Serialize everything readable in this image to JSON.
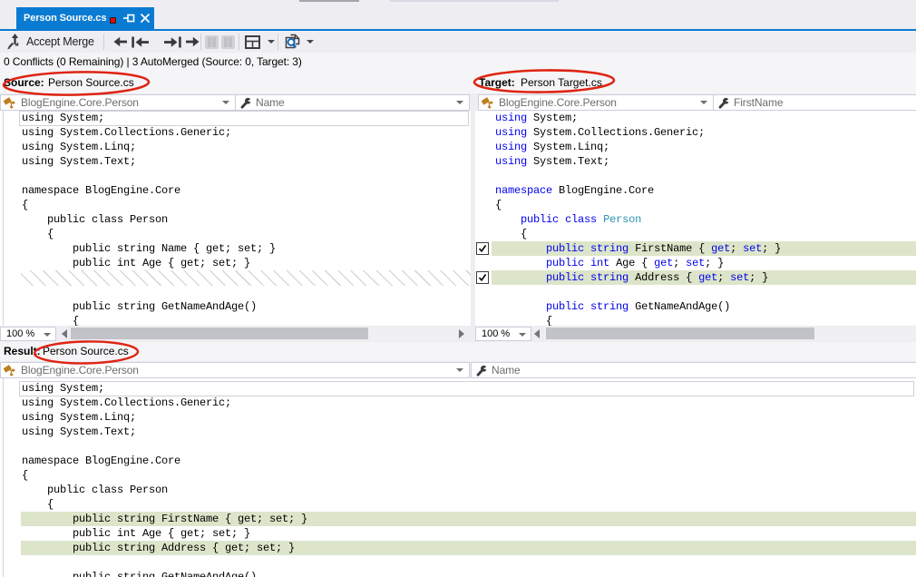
{
  "tab": {
    "title": "Person Source.cs"
  },
  "toolbar": {
    "accept_merge": "Accept Merge",
    "nav_icons": [
      "previous-difference",
      "first-difference",
      "last-difference",
      "next-difference"
    ]
  },
  "status": {
    "text": "0 Conflicts (0 Remaining) | 3 AutoMerged (Source: 0, Target: 3)"
  },
  "panes": {
    "source": {
      "label": "Source:",
      "file": "Person Source.cs",
      "nav_scope": "BlogEngine.Core.Person",
      "nav_member": "Name",
      "zoom": "100 %",
      "lines": [
        {
          "text": "using System;",
          "box": true
        },
        {
          "text": "using System.Collections.Generic;"
        },
        {
          "text": "using System.Linq;"
        },
        {
          "text": "using System.Text;"
        },
        {
          "text": ""
        },
        {
          "text": "namespace BlogEngine.Core"
        },
        {
          "text": "{"
        },
        {
          "text": "    public class Person"
        },
        {
          "text": "    {"
        },
        {
          "text": "        public string Name { get; set; }"
        },
        {
          "text": "        public int Age { get; set; }"
        },
        {
          "hatch": true
        },
        {
          "text": ""
        },
        {
          "text": "        public string GetNameAndAge()"
        },
        {
          "text": "        {"
        }
      ]
    },
    "target": {
      "label": "Target:",
      "file": "Person Target.cs",
      "nav_scope": "BlogEngine.Core.Person",
      "nav_member": "FirstName",
      "zoom": "100 %",
      "lines": [
        {
          "tokens": [
            [
              "k",
              "using"
            ],
            [
              "p",
              " System;"
            ]
          ]
        },
        {
          "tokens": [
            [
              "k",
              "using"
            ],
            [
              "p",
              " System.Collections.Generic;"
            ]
          ]
        },
        {
          "tokens": [
            [
              "k",
              "using"
            ],
            [
              "p",
              " System.Linq;"
            ]
          ]
        },
        {
          "tokens": [
            [
              "k",
              "using"
            ],
            [
              "p",
              " System.Text;"
            ]
          ]
        },
        {
          "tokens": []
        },
        {
          "tokens": [
            [
              "k",
              "namespace"
            ],
            [
              "p",
              " BlogEngine.Core"
            ]
          ]
        },
        {
          "tokens": [
            [
              "p",
              "{"
            ]
          ]
        },
        {
          "tokens": [
            [
              "p",
              "    "
            ],
            [
              "k",
              "public"
            ],
            [
              "p",
              " "
            ],
            [
              "k",
              "class"
            ],
            [
              "p",
              " "
            ],
            [
              "t",
              "Person"
            ]
          ]
        },
        {
          "tokens": [
            [
              "p",
              "    {"
            ]
          ]
        },
        {
          "tokens": [
            [
              "p",
              "        "
            ],
            [
              "k",
              "public"
            ],
            [
              "p",
              " "
            ],
            [
              "k",
              "string"
            ],
            [
              "p",
              " FirstName { "
            ],
            [
              "k",
              "get"
            ],
            [
              "p",
              "; "
            ],
            [
              "k",
              "set"
            ],
            [
              "p",
              "; }"
            ]
          ],
          "hl": true,
          "cb": true
        },
        {
          "tokens": [
            [
              "p",
              "        "
            ],
            [
              "k",
              "public"
            ],
            [
              "p",
              " "
            ],
            [
              "k",
              "int"
            ],
            [
              "p",
              " Age { "
            ],
            [
              "k",
              "get"
            ],
            [
              "p",
              "; "
            ],
            [
              "k",
              "set"
            ],
            [
              "p",
              "; }"
            ]
          ]
        },
        {
          "tokens": [
            [
              "p",
              "        "
            ],
            [
              "k",
              "public"
            ],
            [
              "p",
              " "
            ],
            [
              "k",
              "string"
            ],
            [
              "p",
              " Address { "
            ],
            [
              "k",
              "get"
            ],
            [
              "p",
              "; "
            ],
            [
              "k",
              "set"
            ],
            [
              "p",
              "; }"
            ]
          ],
          "hl": true,
          "cb": true
        },
        {
          "tokens": []
        },
        {
          "tokens": [
            [
              "p",
              "        "
            ],
            [
              "k",
              "public"
            ],
            [
              "p",
              " "
            ],
            [
              "k",
              "string"
            ],
            [
              "p",
              " GetNameAndAge()"
            ]
          ]
        },
        {
          "tokens": [
            [
              "p",
              "        {"
            ]
          ]
        }
      ]
    },
    "result": {
      "label": "Result:",
      "file": "Person Source.cs",
      "nav_scope": "BlogEngine.Core.Person",
      "nav_member": "Name",
      "lines": [
        {
          "text": "using System;",
          "box": true
        },
        {
          "text": "using System.Collections.Generic;"
        },
        {
          "text": "using System.Linq;"
        },
        {
          "text": "using System.Text;"
        },
        {
          "text": ""
        },
        {
          "text": "namespace BlogEngine.Core"
        },
        {
          "text": "{"
        },
        {
          "text": "    public class Person"
        },
        {
          "text": "    {"
        },
        {
          "text": "        public string FirstName { get; set; }",
          "hl": true
        },
        {
          "text": "        public int Age { get; set; }"
        },
        {
          "text": "        public string Address { get; set; }",
          "hl": true
        },
        {
          "text": ""
        },
        {
          "text": "        public string GetNameAndAge()"
        }
      ]
    }
  },
  "colors": {
    "accent_blue": "#0a7bd2",
    "highlight_olive": "#dce5c9",
    "keyword_blue": "#0000ee",
    "type_teal": "#2b91af",
    "annotation_red": "#df2413"
  }
}
